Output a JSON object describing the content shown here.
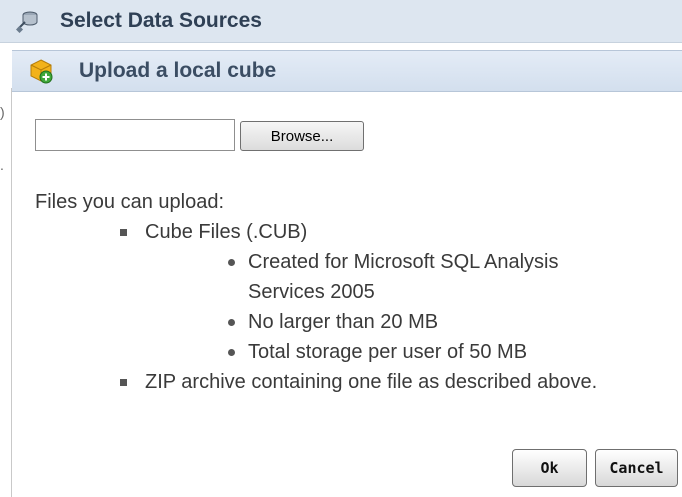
{
  "outer_header": {
    "title": "Select Data Sources",
    "icon": "database-plug-icon"
  },
  "dialog": {
    "title": "Upload a local cube",
    "icon": "cube-add-icon",
    "file_input": {
      "value": "",
      "placeholder": ""
    },
    "browse_label": "Browse...",
    "files_label": "Files you can upload:",
    "file_types": [
      {
        "label": "Cube Files (.CUB)",
        "details": [
          "Created for Microsoft SQL Analysis Services 2005",
          "No larger than 20 MB",
          "Total storage per user of 50 MB"
        ]
      },
      {
        "label": "ZIP archive containing one file as described above."
      }
    ],
    "ok_label": "Ok",
    "cancel_label": "Cancel"
  },
  "colors": {
    "header_bg": "#dde6f0",
    "dialog_header_bg": "#d3dfee",
    "title_text": "#2f4055",
    "body_text": "#3a3a3a"
  }
}
